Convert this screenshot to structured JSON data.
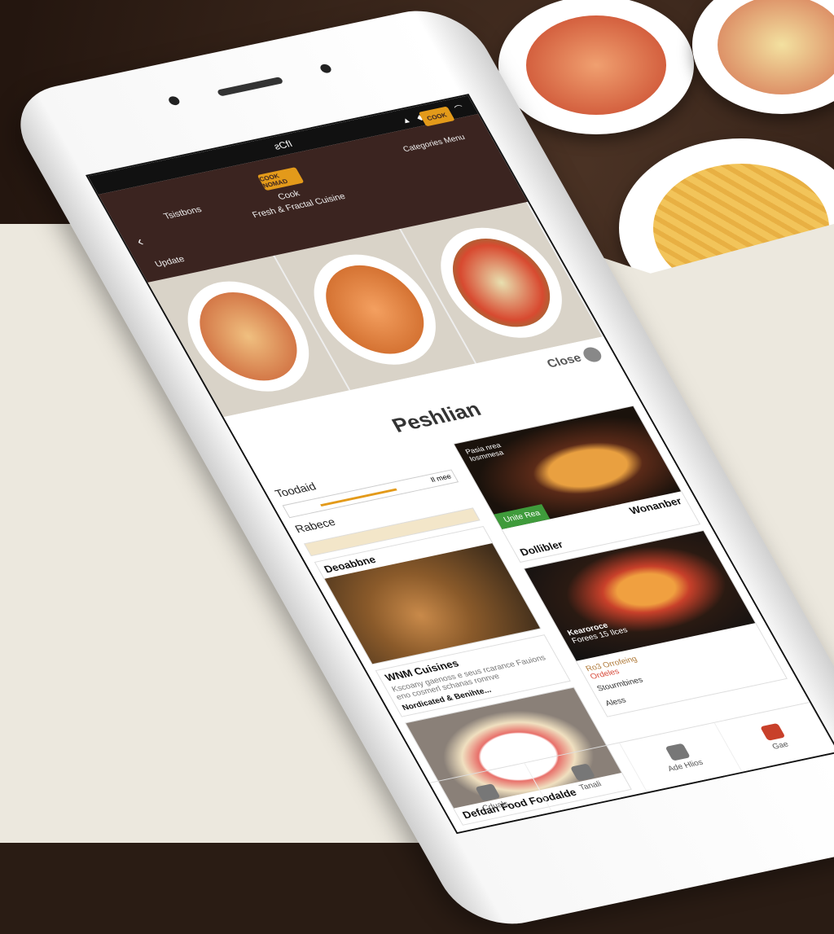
{
  "status_bar": {
    "time": "ƨCfI",
    "icons": "▲ ◆ ✉ ▮ ⌒"
  },
  "header": {
    "left_label": "Tsistbons",
    "sub_label": "Update",
    "logo_text": "COOK NOMAD",
    "logo_right_text": "COOK",
    "tagline_1": "Cook",
    "tagline_2": "Fresh & Fractal Cuisine",
    "right_label": "Categories Menu"
  },
  "panel": {
    "close_label": "Close",
    "title": "Peshlian"
  },
  "left": {
    "filter_label": "Toodaid",
    "slider_label": "Il mee",
    "slider_value": 0.45,
    "search_label": "Rabece",
    "card1_title": "Deoabbne",
    "card2_title": "WNM Cuisines",
    "card2_text": "Kscoany gaenoss e seus rcarance Fauions eno cosmerl schanas ronnve",
    "card2_link": "Nordicated & Benihte...",
    "card3_title": "Defdan Food Foodalde"
  },
  "right": {
    "burger_caption_1": "Pasia nrea",
    "burger_caption_2": "Iosmmesa",
    "order_button": "Unite Rea",
    "burger_label": "Wonanber",
    "burger_title": "Dollibler",
    "pizza_caption_1": "Kearoroce",
    "pizza_caption_2": "Forees 15 Ilces",
    "info_1": "Ro3 Orrofeing",
    "info_2": "Ordeles",
    "info_3": "Stourmbines",
    "info_4": "Aless"
  },
  "nav": [
    {
      "label": "Cduals"
    },
    {
      "label": "Tanali"
    },
    {
      "label": "Ade Hlios"
    },
    {
      "label": "Gae"
    }
  ],
  "colors": {
    "header": "#3b2420",
    "accent": "#e39a1a",
    "green": "#3f9b3b"
  }
}
